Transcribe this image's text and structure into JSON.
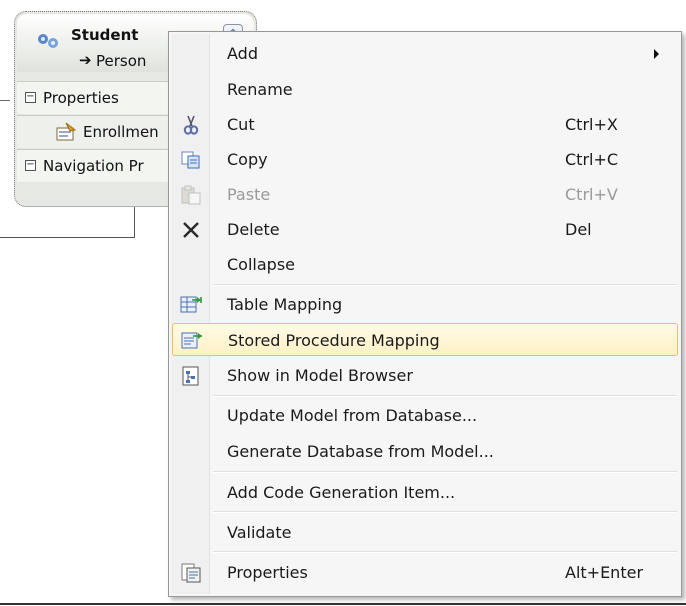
{
  "entity": {
    "name": "Student",
    "base_arrow": "➔",
    "base_type": "Person",
    "sections": {
      "properties": {
        "expander": "−",
        "label": "Properties"
      },
      "property_item": {
        "label": "Enrollmen"
      },
      "navigation": {
        "expander": "−",
        "label": "Navigation Pr"
      }
    },
    "collapse_glyph": "⌃"
  },
  "context_menu": {
    "items": [
      {
        "label": "Add",
        "shortcut": "",
        "icon": "",
        "submenu": true
      },
      {
        "label": "Rename",
        "shortcut": "",
        "icon": ""
      },
      {
        "label": "Cut",
        "shortcut": "Ctrl+X",
        "icon": "scissors-icon"
      },
      {
        "label": "Copy",
        "shortcut": "Ctrl+C",
        "icon": "copy-icon"
      },
      {
        "label": "Paste",
        "shortcut": "Ctrl+V",
        "icon": "paste-icon",
        "disabled": true
      },
      {
        "label": "Delete",
        "shortcut": "Del",
        "icon": "delete-x-icon"
      },
      {
        "label": "Collapse",
        "shortcut": "",
        "icon": ""
      },
      {
        "label": "Table Mapping",
        "shortcut": "",
        "icon": "table-mapping-icon"
      },
      {
        "label": "Stored Procedure Mapping",
        "shortcut": "",
        "icon": "stored-procedure-mapping-icon",
        "highlighted": true
      },
      {
        "label": "Show in Model Browser",
        "shortcut": "",
        "icon": "model-browser-icon"
      },
      {
        "label": "Update Model from Database...",
        "shortcut": "",
        "icon": ""
      },
      {
        "label": "Generate Database from Model...",
        "shortcut": "",
        "icon": ""
      },
      {
        "label": "Add Code Generation Item...",
        "shortcut": "",
        "icon": ""
      },
      {
        "label": "Validate",
        "shortcut": "",
        "icon": ""
      },
      {
        "label": "Properties",
        "shortcut": "Alt+Enter",
        "icon": "properties-icon"
      }
    ]
  },
  "colors": {
    "highlight_border": "#e5c365",
    "highlight_fill": "#fff1c5",
    "menu_background": "#f6f6f6",
    "disabled_text": "#9a9a9a"
  }
}
